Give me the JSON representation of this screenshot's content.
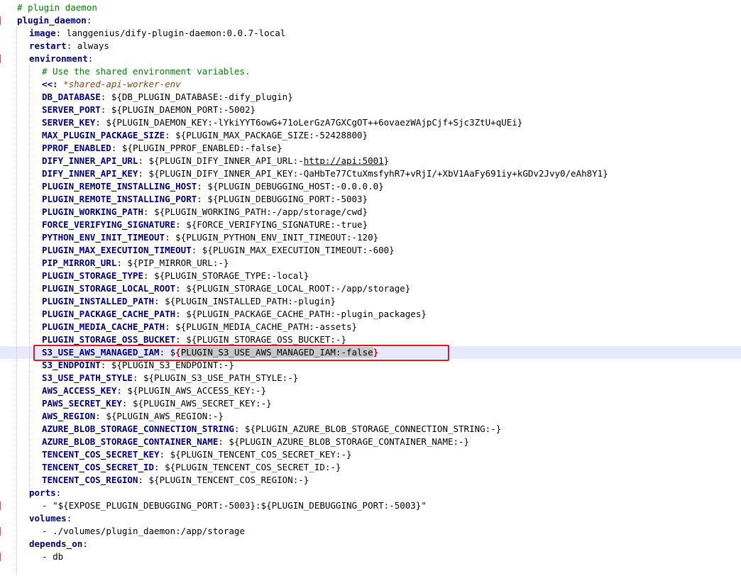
{
  "editor": {
    "lines": [
      {
        "indent": 1,
        "type": "comment",
        "text": "# plugin daemon"
      },
      {
        "indent": 1,
        "type": "key",
        "key": "plugin_daemon",
        "value": ""
      },
      {
        "indent": 2,
        "type": "key",
        "key": "image",
        "value": "langgenius/dify-plugin-daemon:0.0.7-local"
      },
      {
        "indent": 2,
        "type": "key",
        "key": "restart",
        "value": "always"
      },
      {
        "indent": 2,
        "type": "key",
        "key": "environment",
        "value": ""
      },
      {
        "indent": 3,
        "type": "comment",
        "text": "# Use the shared environment variables."
      },
      {
        "indent": 3,
        "type": "merge",
        "key": "<<:",
        "value": "*shared-api-worker-env"
      },
      {
        "indent": 3,
        "type": "key",
        "key": "DB_DATABASE",
        "value": "${DB_PLUGIN_DATABASE:-dify_plugin}"
      },
      {
        "indent": 3,
        "type": "key",
        "key": "SERVER_PORT",
        "value": "${PLUGIN_DAEMON_PORT:-5002}"
      },
      {
        "indent": 3,
        "type": "key",
        "key": "SERVER_KEY",
        "value": "${PLUGIN_DAEMON_KEY:-lYkiYYT6owG+71oLerGzA7GXCgOT++6ovaezWAjpCjf+Sjc3ZtU+qUEi}"
      },
      {
        "indent": 3,
        "type": "key",
        "key": "MAX_PLUGIN_PACKAGE_SIZE",
        "value": "${PLUGIN_MAX_PACKAGE_SIZE:-52428800}"
      },
      {
        "indent": 3,
        "type": "key",
        "key": "PPROF_ENABLED",
        "value": "${PLUGIN_PPROF_ENABLED:-false}"
      },
      {
        "indent": 3,
        "type": "url",
        "key": "DIFY_INNER_API_URL",
        "value_pre": "${PLUGIN_DIFY_INNER_API_URL:-",
        "value_url": "http://api:5001",
        "value_post": "}"
      },
      {
        "indent": 3,
        "type": "key",
        "key": "DIFY_INNER_API_KEY",
        "value": "${PLUGIN_DIFY_INNER_API_KEY:-QaHbTe77CtuXmsfyhR7+vRjI/+XbV1AaFy691iy+kGDv2Jvy0/eAh8Y1}"
      },
      {
        "indent": 3,
        "type": "key",
        "key": "PLUGIN_REMOTE_INSTALLING_HOST",
        "value": "${PLUGIN_DEBUGGING_HOST:-0.0.0.0}"
      },
      {
        "indent": 3,
        "type": "key",
        "key": "PLUGIN_REMOTE_INSTALLING_PORT",
        "value": "${PLUGIN_DEBUGGING_PORT:-5003}"
      },
      {
        "indent": 3,
        "type": "key",
        "key": "PLUGIN_WORKING_PATH",
        "value": "${PLUGIN_WORKING_PATH:-/app/storage/cwd}"
      },
      {
        "indent": 3,
        "type": "key",
        "key": "FORCE_VERIFYING_SIGNATURE",
        "value": "${FORCE_VERIFYING_SIGNATURE:-true}"
      },
      {
        "indent": 3,
        "type": "key",
        "key": "PYTHON_ENV_INIT_TIMEOUT",
        "value": "${PLUGIN_PYTHON_ENV_INIT_TIMEOUT:-120}"
      },
      {
        "indent": 3,
        "type": "key",
        "key": "PLUGIN_MAX_EXECUTION_TIMEOUT",
        "value": "${PLUGIN_MAX_EXECUTION_TIMEOUT:-600}"
      },
      {
        "indent": 3,
        "type": "key",
        "key": "PIP_MIRROR_URL",
        "value": "${PIP_MIRROR_URL:-}"
      },
      {
        "indent": 3,
        "type": "key",
        "key": "PLUGIN_STORAGE_TYPE",
        "value": "${PLUGIN_STORAGE_TYPE:-local}"
      },
      {
        "indent": 3,
        "type": "key",
        "key": "PLUGIN_STORAGE_LOCAL_ROOT",
        "value": "${PLUGIN_STORAGE_LOCAL_ROOT:-/app/storage}"
      },
      {
        "indent": 3,
        "type": "key",
        "key": "PLUGIN_INSTALLED_PATH",
        "value": "${PLUGIN_INSTALLED_PATH:-plugin}"
      },
      {
        "indent": 3,
        "type": "key",
        "key": "PLUGIN_PACKAGE_CACHE_PATH",
        "value": "${PLUGIN_PACKAGE_CACHE_PATH:-plugin_packages}"
      },
      {
        "indent": 3,
        "type": "key",
        "key": "PLUGIN_MEDIA_CACHE_PATH",
        "value": "${PLUGIN_MEDIA_CACHE_PATH:-assets}"
      },
      {
        "indent": 3,
        "type": "key",
        "key": "PLUGIN_STORAGE_OSS_BUCKET",
        "value": "${PLUGIN_STORAGE_OSS_BUCKET:-}"
      },
      {
        "indent": 3,
        "type": "highlight",
        "key": "S3_USE_AWS_MANAGED_IAM",
        "value_pre": "$",
        "value_brace_open": "{",
        "value_inner": "PLUGIN_S3_USE_AWS_MANAGED_IAM:-false",
        "value_brace_close": "}"
      },
      {
        "indent": 3,
        "type": "key",
        "key": "S3_ENDPOINT",
        "value": "${PLUGIN_S3_ENDPOINT:-}"
      },
      {
        "indent": 3,
        "type": "key",
        "key": "S3_USE_PATH_STYLE",
        "value": "${PLUGIN_S3_USE_PATH_STYLE:-}"
      },
      {
        "indent": 3,
        "type": "key",
        "key": "AWS_ACCESS_KEY",
        "value": "${PLUGIN_AWS_ACCESS_KEY:-}"
      },
      {
        "indent": 3,
        "type": "key",
        "key": "PAWS_SECRET_KEY",
        "value": "${PLUGIN_AWS_SECRET_KEY:-}"
      },
      {
        "indent": 3,
        "type": "key",
        "key": "AWS_REGION",
        "value": "${PLUGIN_AWS_REGION:-}"
      },
      {
        "indent": 3,
        "type": "key",
        "key": "AZURE_BLOB_STORAGE_CONNECTION_STRING",
        "value": "${PLUGIN_AZURE_BLOB_STORAGE_CONNECTION_STRING:-}"
      },
      {
        "indent": 3,
        "type": "key",
        "key": "AZURE_BLOB_STORAGE_CONTAINER_NAME",
        "value": "${PLUGIN_AZURE_BLOB_STORAGE_CONTAINER_NAME:-}"
      },
      {
        "indent": 3,
        "type": "key",
        "key": "TENCENT_COS_SECRET_KEY",
        "value": "${PLUGIN_TENCENT_COS_SECRET_KEY:-}"
      },
      {
        "indent": 3,
        "type": "key",
        "key": "TENCENT_COS_SECRET_ID",
        "value": "${PLUGIN_TENCENT_COS_SECRET_ID:-}"
      },
      {
        "indent": 3,
        "type": "key",
        "key": "TENCENT_COS_REGION",
        "value": "${PLUGIN_TENCENT_COS_REGION:-}"
      },
      {
        "indent": 2,
        "type": "key",
        "key": "ports",
        "value": ""
      },
      {
        "indent": 3,
        "type": "list",
        "text": "\"${EXPOSE_PLUGIN_DEBUGGING_PORT:-5003}:${PLUGIN_DEBUGGING_PORT:-5003}\""
      },
      {
        "indent": 2,
        "type": "key",
        "key": "volumes",
        "value": ""
      },
      {
        "indent": 3,
        "type": "list",
        "text": "./volumes/plugin_daemon:/app/storage"
      },
      {
        "indent": 2,
        "type": "key",
        "key": "depends_on",
        "value": ""
      },
      {
        "indent": 3,
        "type": "list",
        "text": "db"
      }
    ]
  }
}
